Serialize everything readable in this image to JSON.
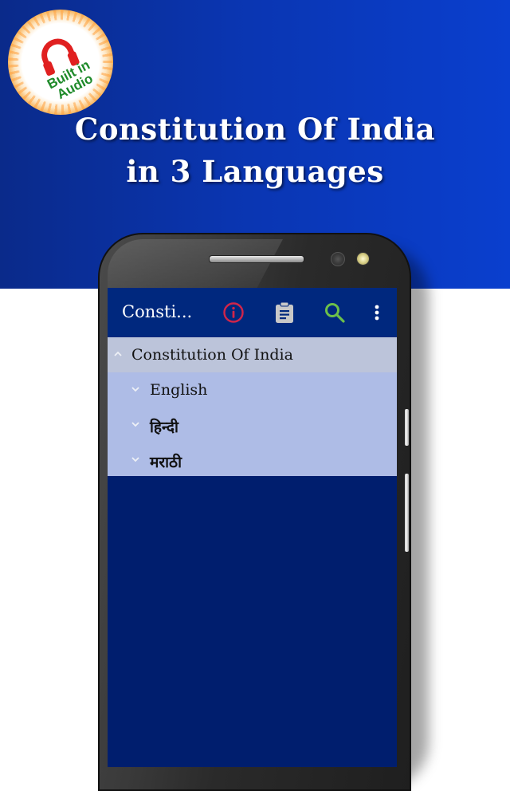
{
  "promo": {
    "badge": {
      "icon": "headphones-icon",
      "line1": "Built in",
      "line2": "Audio"
    },
    "headline_line1": "Constitution Of India",
    "headline_line2": "in 3 Languages"
  },
  "colors": {
    "banner_blue": "#0a35b0",
    "appbar": "#00287e",
    "screen_bg": "#001e6e",
    "parent_row": "#bcc4da",
    "child_row": "#aebce6",
    "info_icon": "#d0254a",
    "search_icon": "#6cc04a",
    "clipboard_icon": "#c8c8c8",
    "badge_text": "#1e8a2a",
    "headphones": "#e02020"
  },
  "app": {
    "appbar": {
      "title": "Consti...",
      "actions": [
        {
          "name": "info",
          "icon": "info-icon"
        },
        {
          "name": "clipboard",
          "icon": "clipboard-icon"
        },
        {
          "name": "search",
          "icon": "search-icon"
        },
        {
          "name": "more",
          "icon": "more-vert-icon"
        }
      ]
    },
    "tree": {
      "parent": {
        "label": "Constitution Of India",
        "expanded": true
      },
      "children": [
        {
          "label": "English",
          "expanded": false
        },
        {
          "label": "हिन्दी",
          "expanded": false
        },
        {
          "label": "मराठी",
          "expanded": false
        }
      ]
    }
  }
}
